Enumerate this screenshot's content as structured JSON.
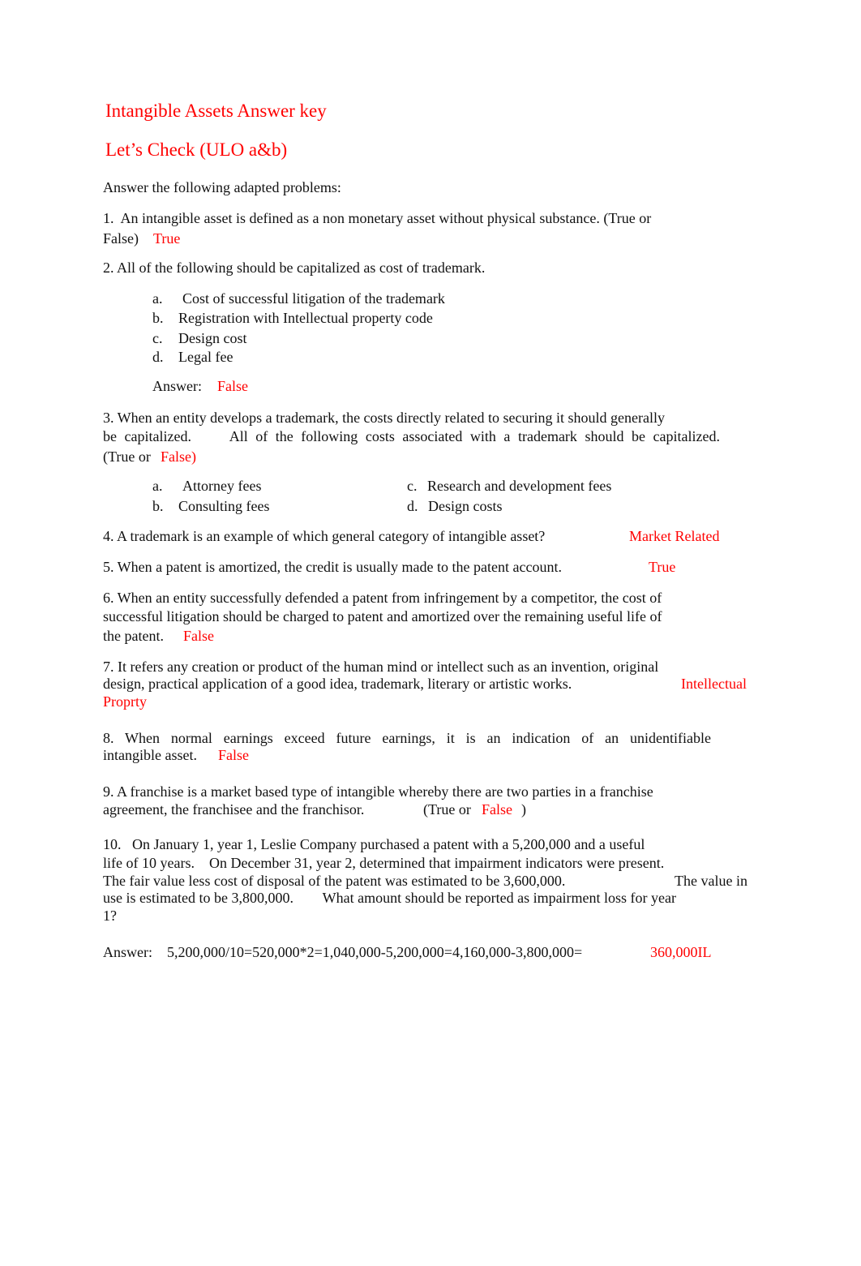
{
  "document": {
    "title": "Intangible Assets Answer key",
    "subtitle": "Let’s Check (ULO a&b)",
    "instructions": "Answer the following adapted problems:",
    "answer_color": "#ff0000",
    "questions": [
      {
        "lines": [
          "1.  An intangible asset is defined as a non monetary asset without physical substance. (True or",
          "False)"
        ],
        "answer": "True"
      },
      {
        "lines": [
          "2. All of the following should be capitalized as cost of trademark."
        ],
        "options": [
          {
            "letter": "a.",
            "text": "Cost of successful litigation of the trademark"
          },
          {
            "letter": "b.",
            "text": "Registration with Intellectual property code"
          },
          {
            "letter": "c.",
            "text": "Design cost"
          },
          {
            "letter": "d.",
            "text": "Legal fee"
          }
        ],
        "answer_label": "Answer:",
        "answer": "False"
      },
      {
        "lines": [
          "3. When an entity develops a trademark, the costs directly related to securing it should generally",
          "be capitalized.     All of the following costs associated with a trademark should be capitalized.",
          "(True or"
        ],
        "answer": "False)",
        "options": [
          {
            "letter": "a.",
            "text": "Attorney fees"
          },
          {
            "letter": "b.",
            "text": "Consulting fees"
          },
          {
            "letter": "c.",
            "text": "Research and development fees"
          },
          {
            "letter": "d.",
            "text": "Design costs"
          }
        ]
      },
      {
        "lines": [
          "4. A trademark is an example of which general category of intangible asset?"
        ],
        "answer": "Market Related"
      },
      {
        "lines": [
          "5. When a patent is amortized, the credit is usually made to the patent account."
        ],
        "answer": "True"
      },
      {
        "lines": [
          "6. When an entity successfully defended a patent from infringement by a competitor, the cost of",
          "successful litigation should be charged to patent and amortized over the remaining useful life of",
          "the patent."
        ],
        "answer": "False"
      },
      {
        "lines": [
          "7. It refers any creation or product of the human mind or intellect such as an invention, original",
          "design, practical application of a good idea, trademark, literary or artistic works."
        ],
        "answer_lines": [
          "Intellectual",
          "Proprty"
        ]
      },
      {
        "lines": [
          "8. When normal earnings exceed future earnings, it is an indication of an unidentifiable",
          "intangible asset."
        ],
        "answer": "False"
      },
      {
        "lines": [
          "9. A franchise is a market based type of intangible whereby there are two parties in a franchise",
          "agreement, the franchisee and the franchisor.",
          "(True or"
        ],
        "answer": "False",
        "closing": ")"
      },
      {
        "lines": [
          "10.   On January 1, year 1, Leslie Company purchased a patent with a 5,200,000 and a useful",
          "life of 10 years.    On December 31, year 2, determined that impairment indicators were present.",
          "The fair value less cost of disposal of the patent was estimated to be 3,600,000.",
          "The value in",
          "use is estimated to be 3,800,000.        What amount should be reported as impairment loss for year",
          "1?"
        ],
        "answer_label": "Answer:",
        "computation": "5,200,000/10=520,000*2=1,040,000-5,200,000=4,160,000-3,800,000=",
        "answer": "360,000IL"
      }
    ]
  }
}
